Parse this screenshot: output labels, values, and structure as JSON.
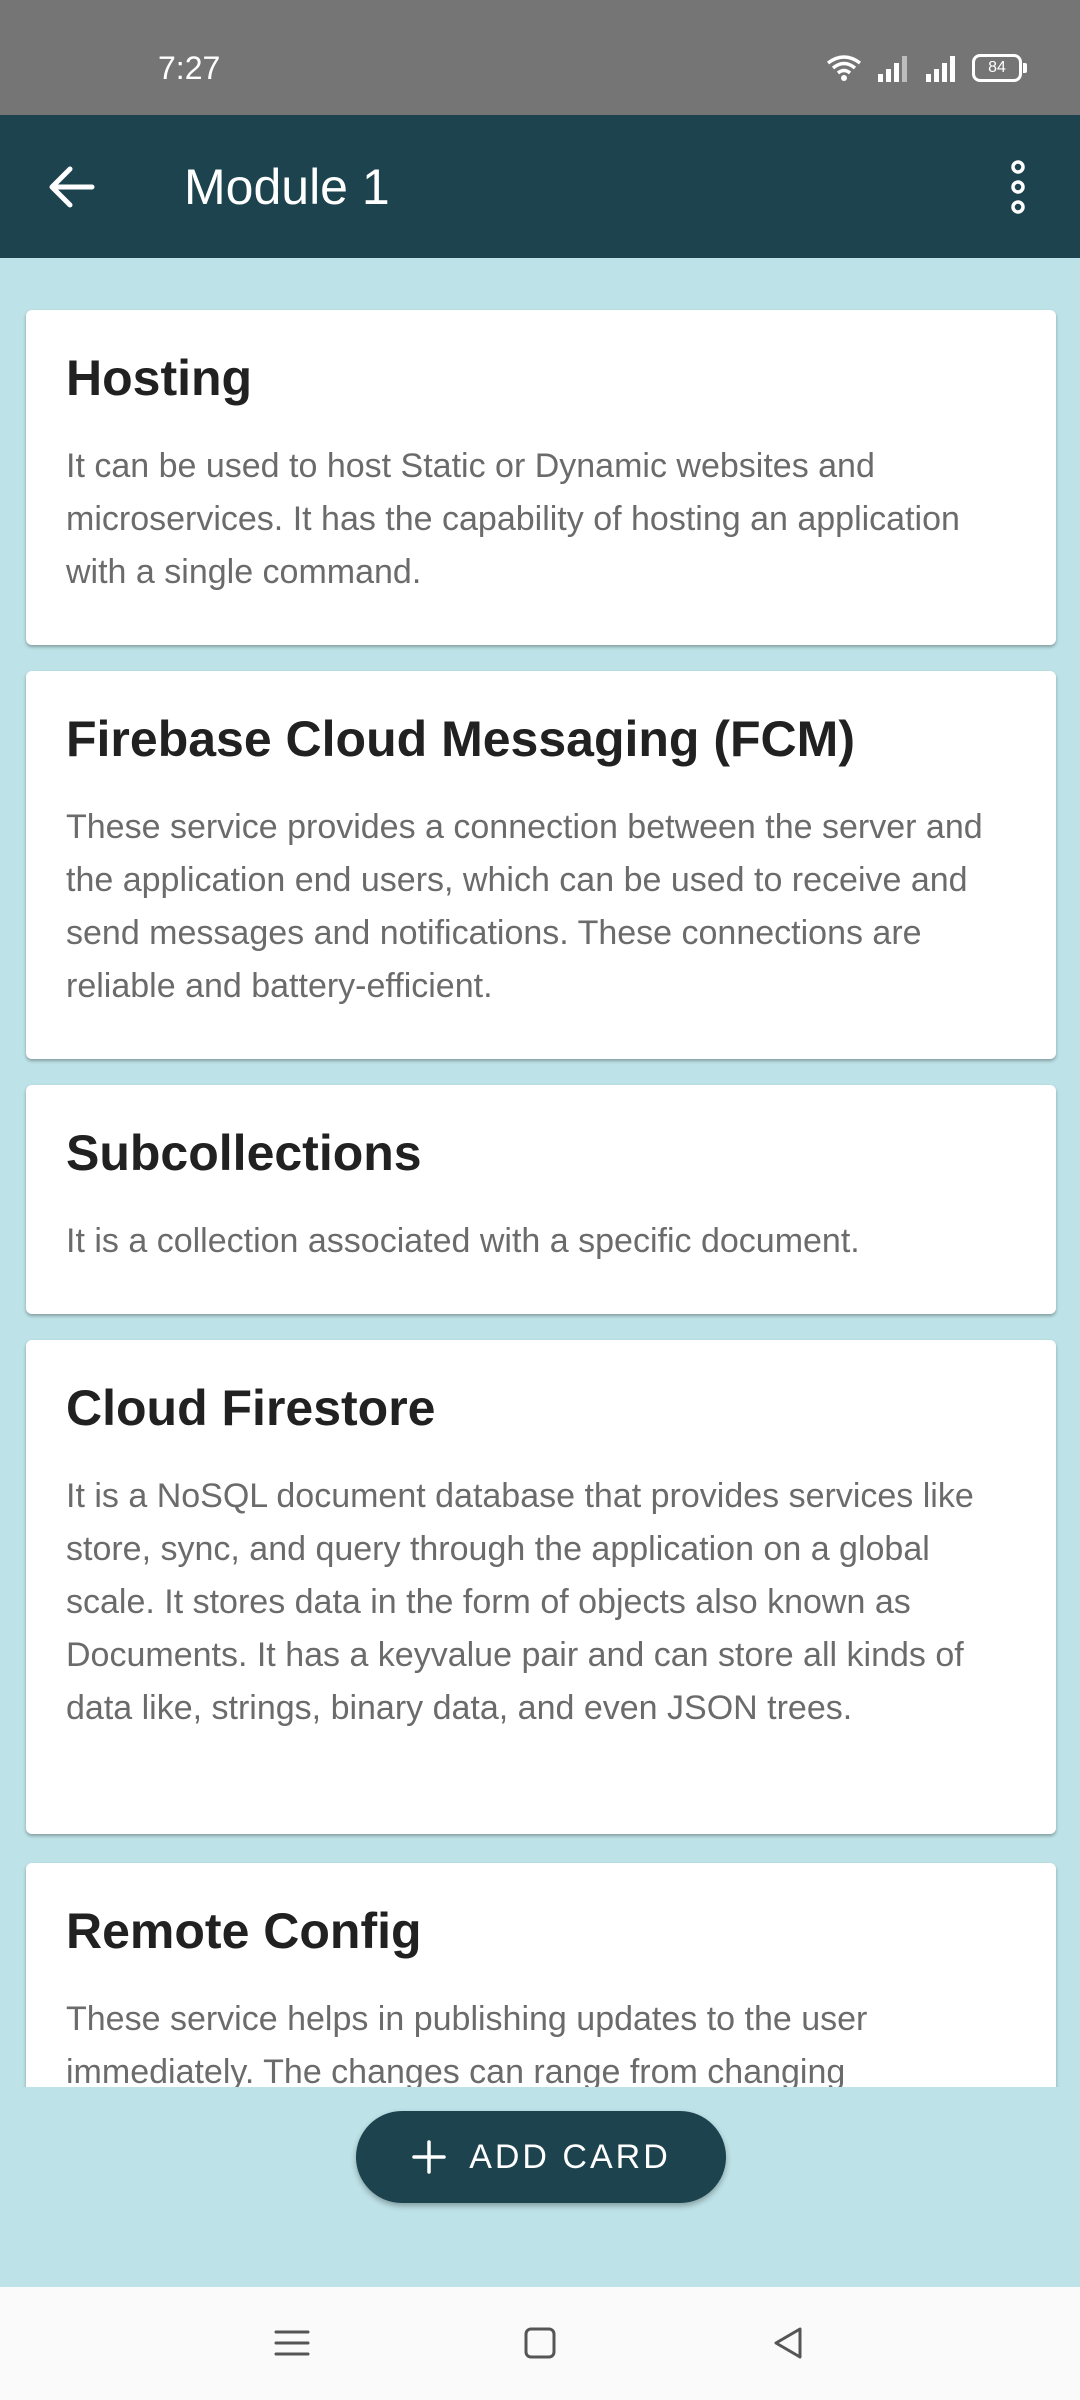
{
  "status_bar": {
    "time": "7:27",
    "battery": "84",
    "icons": [
      "wifi-icon",
      "signal-icon",
      "signal-icon",
      "battery-icon"
    ]
  },
  "app_bar": {
    "title": "Module 1",
    "back_icon": "arrow-back-icon",
    "menu_icon": "more-vert-icon"
  },
  "cards": [
    {
      "title": "Hosting",
      "body": "It can be used to host Static or Dynamic websites and microservices. It has the capability of hosting an application with a single command."
    },
    {
      "title": "Firebase Cloud Messaging (FCM)",
      "body": "These service provides a connection between the server and the application end users, which can be used to receive and send messages and notifications. These connections are reliable and battery-efficient."
    },
    {
      "title": "Subcollections",
      "body": "It is a collection associated with a specific document."
    },
    {
      "title": "Cloud Firestore",
      "body": "It is a NoSQL document database that provides services like store, sync, and query through the application on a global scale. It stores data in the form of objects also known as Documents. It has a keyvalue pair and can store all kinds of data like, strings, binary data, and even JSON trees."
    },
    {
      "title": "Remote Config",
      "body": "These service helps in publishing updates to the user immediately. The changes can range from changing"
    }
  ],
  "fab": {
    "label": "ADD CARD",
    "icon": "plus-icon"
  },
  "nav_bar": {
    "icons": [
      "menu-icon",
      "home-icon",
      "back-icon"
    ]
  },
  "colors": {
    "app_bar": "#1c434e",
    "background": "#bde2e7",
    "status_bar": "#757575"
  }
}
